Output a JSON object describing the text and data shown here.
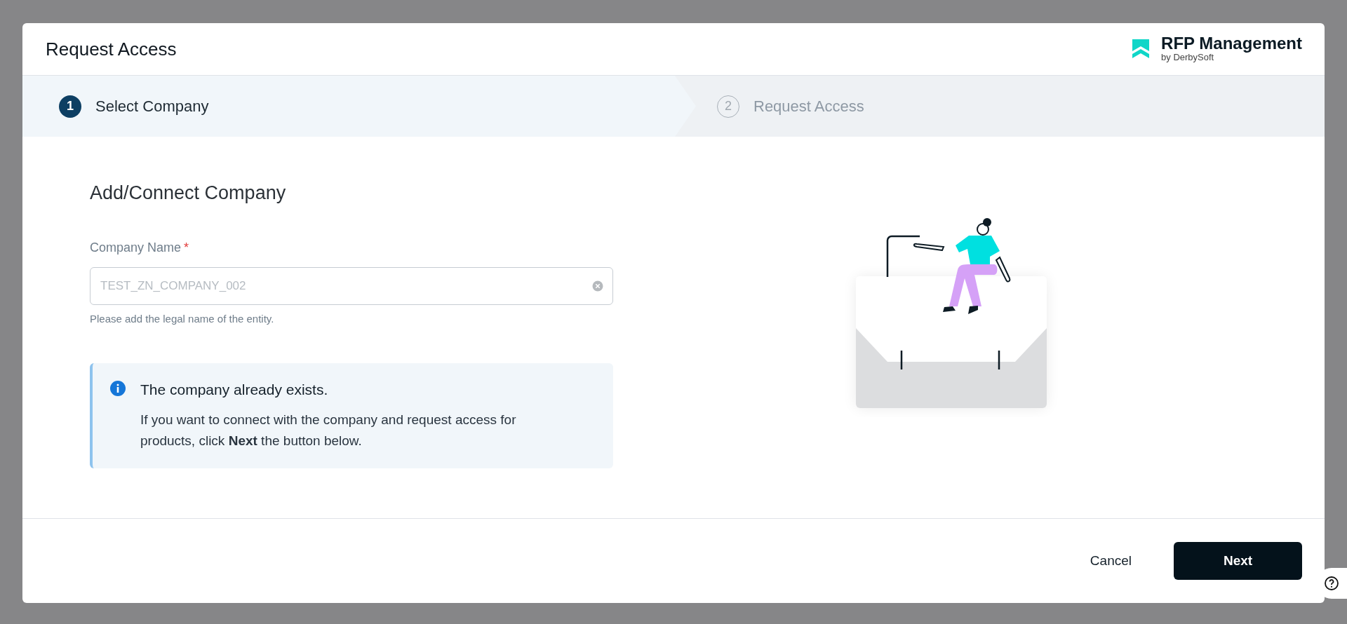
{
  "dialog": {
    "title": "Request Access"
  },
  "brand": {
    "name": "RFP Management",
    "byline": "by DerbySoft"
  },
  "steps": [
    {
      "number": "1",
      "label": "Select Company",
      "selected": true
    },
    {
      "number": "2",
      "label": "Request Access",
      "selected": false
    }
  ],
  "section": {
    "heading": "Add/Connect Company"
  },
  "field": {
    "label": "Company Name",
    "required_marker": "*",
    "value": "TEST_ZN_COMPANY_002",
    "help": "Please add the legal name of the entity."
  },
  "alert": {
    "title": "The company already exists.",
    "body": "If you want to connect with the company and request access for products, click **Next** the button below."
  },
  "buttons": [
    {
      "label": "Cancel",
      "kind": "secondary"
    },
    {
      "label": "Next",
      "kind": "primary"
    }
  ]
}
